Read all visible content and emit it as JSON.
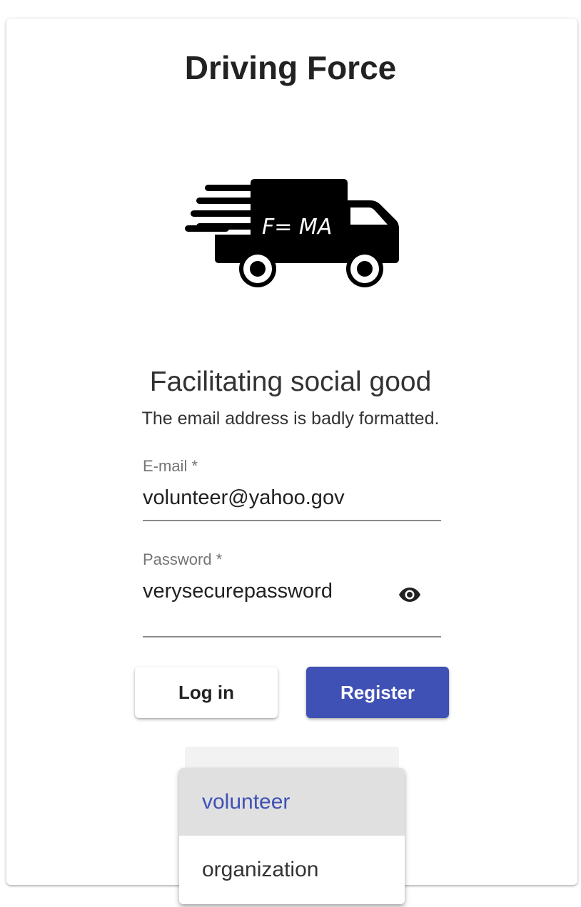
{
  "app": {
    "title": "Driving Force",
    "logo_text": "F= MA",
    "tagline": "Facilitating social good",
    "error_message": "The email address is badly formatted."
  },
  "form": {
    "email": {
      "label": "E-mail *",
      "value": "volunteer@yahoo.gov"
    },
    "password": {
      "label": "Password *",
      "value": "verysecurepassword",
      "toggle_icon": "eye-icon"
    }
  },
  "buttons": {
    "login_label": "Log in",
    "register_label": "Register"
  },
  "role_menu": {
    "options": [
      "volunteer",
      "organization"
    ],
    "selected": "volunteer"
  },
  "colors": {
    "accent": "#3f51b5",
    "text": "#212121",
    "label": "#757575",
    "selected_bg": "#e0e0e0"
  }
}
